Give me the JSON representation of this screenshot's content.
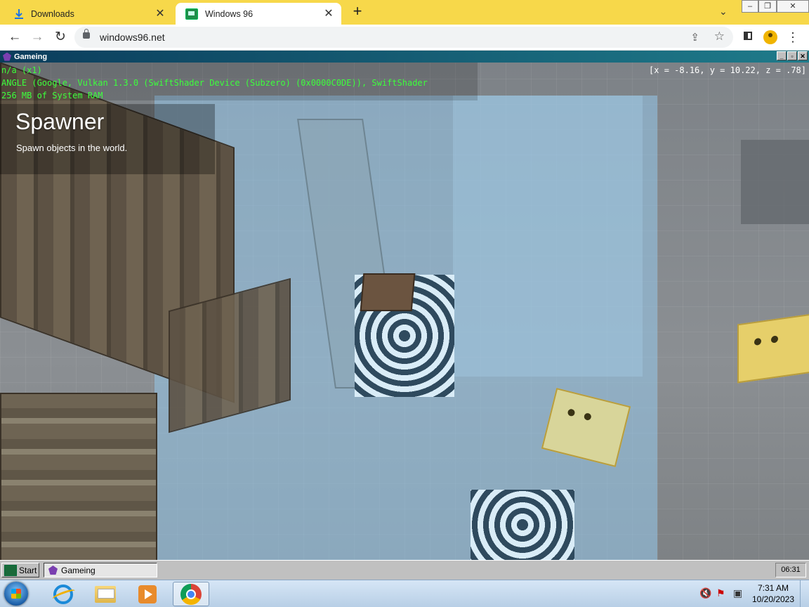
{
  "browser": {
    "tabs": [
      {
        "label": "Downloads",
        "icon": "download-icon"
      },
      {
        "label": "Windows 96",
        "icon": "windows96-icon"
      }
    ],
    "url": "windows96.net"
  },
  "window": {
    "title": "Gameing"
  },
  "game": {
    "hud_lines": [
      "n/a (x1)",
      "ANGLE (Google, Vulkan 1.3.0 (SwiftShader Device (Subzero) (0x0000C0DE)), SwiftShader",
      "256 MB of System RAM"
    ],
    "coords": "[x = -8.16, y = 10.22, z = .78]",
    "tool_title": "Spawner",
    "tool_desc": "Spawn objects in the world."
  },
  "w96_taskbar": {
    "start_label": "Start",
    "task_label": "Gameing",
    "clock": "06:31"
  },
  "w7_taskbar": {
    "time": "7:31 AM",
    "date": "10/20/2023"
  },
  "colors": {
    "tabstrip": "#f7d84a",
    "hud_green": "#3cff3c",
    "titlebar_start": "#0b3d5c"
  }
}
